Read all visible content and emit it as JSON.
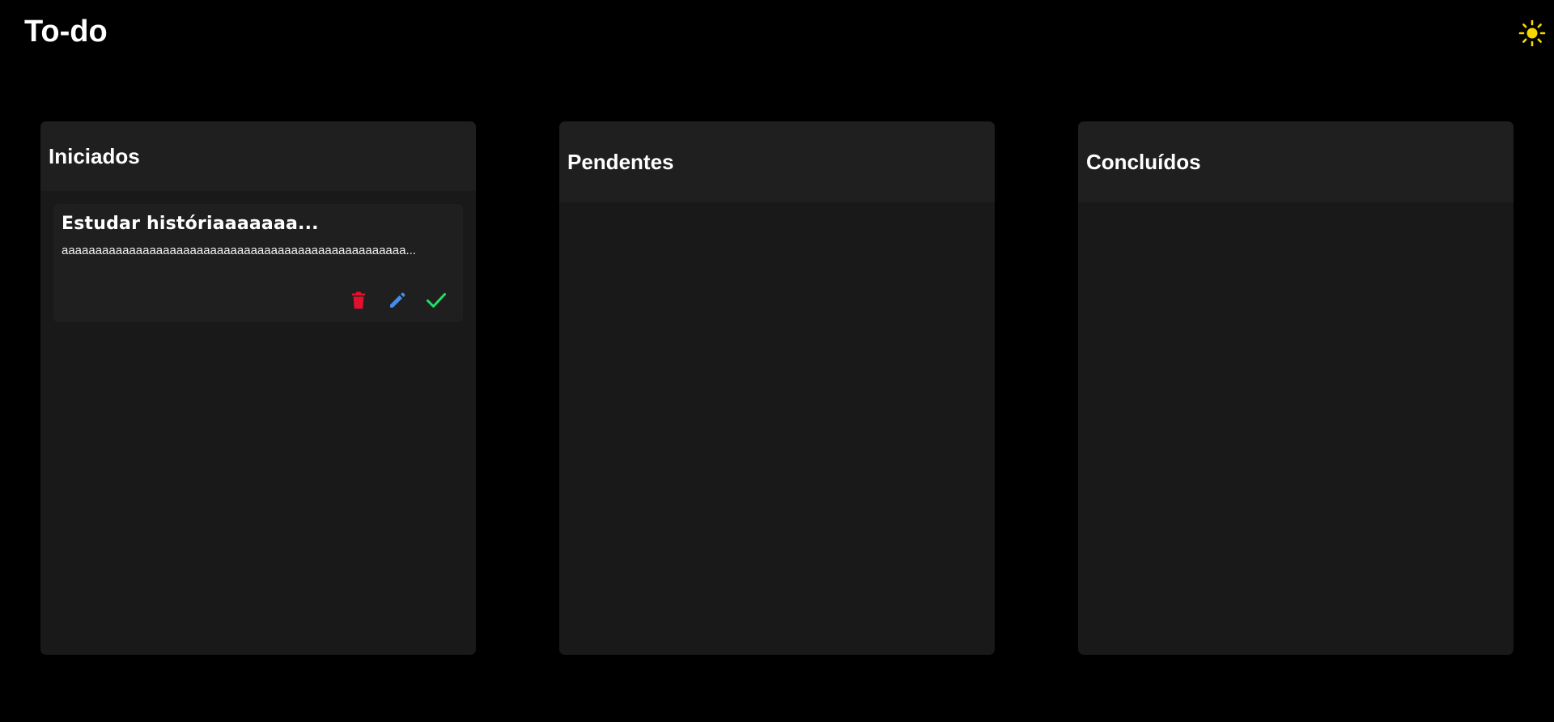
{
  "header": {
    "title": "To-do",
    "theme_icon": "sun-icon",
    "theme_icon_color": "#f5d800"
  },
  "columns": [
    {
      "title": "Iniciados",
      "cards": [
        {
          "title": "Estudar históriaaaaaaa...",
          "description": "aaaaaaaaaaaaaaaaaaaaaaaaaaaaaaaaaaaaaaaaaaaaaaaaaaa...",
          "actions": [
            {
              "icon": "trash-icon",
              "color": "#e0102f"
            },
            {
              "icon": "pencil-icon",
              "color": "#3f8ef0"
            },
            {
              "icon": "check-icon",
              "color": "#1fe06b"
            }
          ]
        }
      ]
    },
    {
      "title": "Pendentes",
      "cards": []
    },
    {
      "title": "Concluídos",
      "cards": []
    }
  ],
  "colors": {
    "background": "#000000",
    "column_background": "#191919",
    "column_header_background": "#1f1f1f",
    "card_background": "#1f1f1f",
    "text": "#ffffff"
  }
}
